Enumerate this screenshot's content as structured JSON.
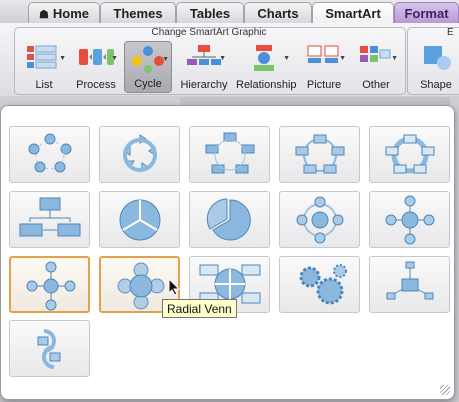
{
  "tabs": [
    {
      "label": "Home",
      "icon": "home-icon"
    },
    {
      "label": "Themes"
    },
    {
      "label": "Tables"
    },
    {
      "label": "Charts"
    },
    {
      "label": "SmartArt"
    },
    {
      "label": "Format"
    }
  ],
  "ribbon": {
    "group_title": "Change SmartArt Graphic",
    "buttons": [
      {
        "label": "List"
      },
      {
        "label": "Process"
      },
      {
        "label": "Cycle"
      },
      {
        "label": "Hierarchy"
      },
      {
        "label": "Relationship"
      },
      {
        "label": "Picture"
      },
      {
        "label": "Other"
      },
      {
        "label": "Shape"
      }
    ],
    "right_group_title_partial": "E"
  },
  "gallery": {
    "tooltip": "Radial Venn",
    "selected_index": 11
  },
  "colors": {
    "accent": "#e3a14b",
    "shape_blue": "#7aaed6",
    "format_tab": "#b79ad6"
  }
}
